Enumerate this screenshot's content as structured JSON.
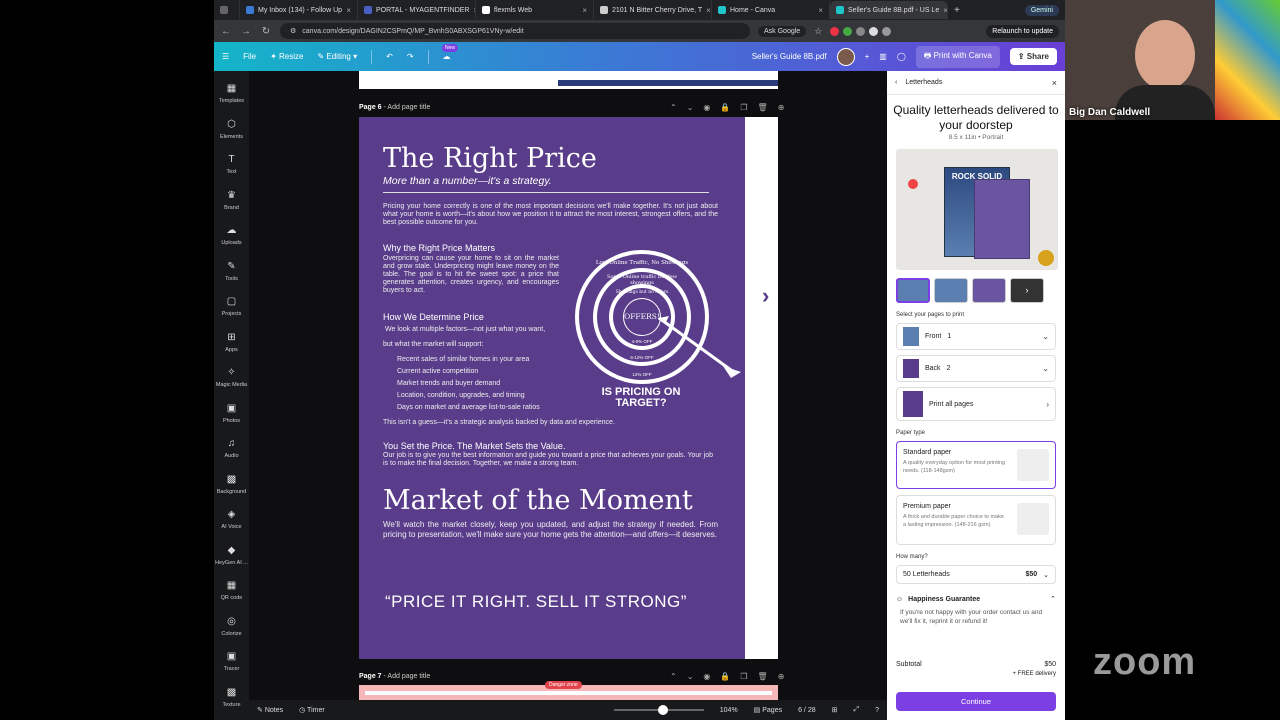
{
  "tabs": [
    {
      "title": "My Inbox (134) - Follow Up",
      "active": false
    },
    {
      "title": "PORTAL - MYAGENTFINDER",
      "active": false
    },
    {
      "title": "flexmls Web",
      "active": false
    },
    {
      "title": "2101 N Bitter Cherry Drive, T",
      "active": false
    },
    {
      "title": "Home - Canva",
      "active": false
    },
    {
      "title": "Seller's Guide 8B.pdf - US Le",
      "active": true
    }
  ],
  "gemini_label": "Gemini",
  "url": "canva.com/design/DAGIN2CSPmQ/MP_BvnhS0ABXSGP61VNy-w/edit",
  "ask_google": "Ask Google",
  "relaunch": "Relaunch to update",
  "canva": {
    "file": "File",
    "resize": "Resize",
    "editing": "Editing",
    "new_badge": "New",
    "doc_title": "Seller's Guide 8B.pdf",
    "print_with_canva": "Print with Canva",
    "share": "Share"
  },
  "rail": [
    "Templates",
    "Elements",
    "Text",
    "Brand",
    "Uploads",
    "Tools",
    "Projects",
    "Apps",
    "Magic Media",
    "Photos",
    "Audio",
    "Background",
    "AI Voice",
    "HeyGen AI ...",
    "QR code",
    "Colorize",
    "Tracer",
    "Texture"
  ],
  "page6": {
    "label": "Page 6",
    "add_title": "- Add page title",
    "title": "The Right Price",
    "subtitle": "More than a number—it's a strategy.",
    "intro": "Pricing your home correctly is one of the most important decisions we'll make together. It's not just about what your home is worth—it's about how we position it to attract the most interest, strongest offers, and the best possible outcome for you.",
    "h_why": "Why the Right Price Matters",
    "why": "Overpricing can cause your home to sit on the market and grow stale. Underpricing might leave money on the table. The goal is to hit the sweet spot: a price that generates attention, creates urgency, and encourages buyers to act.",
    "h_how": "How We Determine Price",
    "how1": "We look at multiple factors—not just what you want,",
    "how2": "but what the market will support:",
    "bullets": [
      "Recent sales of similar homes in your area",
      "Current active competition",
      "Market trends and buyer demand",
      "Location, condition, upgrades, and timing",
      "Days on market and average list-to-sale ratios"
    ],
    "guess": "This isn't a guess—it's a strategic analysis backed by data and experience.",
    "h_set": "You Set the Price. The Market Sets the Value.",
    "set": "Our job is to give you the best information and guide you toward a price that achieves your goals. Your job is to make the final decision. Together, we make a strong team.",
    "moment_title": "Market of the Moment",
    "moment": "We'll watch the market closely, keep you updated, and adjust the strategy if needed. From pricing to presentation, we'll make sure your home gets the attention—and offers—it deserves.",
    "quote": "“PRICE IT RIGHT. SELL IT STRONG”",
    "target": {
      "outer": "Low Online Traffic, No Showings",
      "mid": "Some Online traffic but few showings",
      "inner": "Showings but no offers",
      "center": "OFFERS!",
      "r1": "4-6% OFF",
      "r2": "6-12% OFF",
      "r3": "12% OFF",
      "caption": "IS PRICING ON TARGET?"
    }
  },
  "page7": {
    "label": "Page 7",
    "add_title": "- Add page title",
    "danger": "Danger zone"
  },
  "bottom": {
    "notes": "Notes",
    "timer": "Timer",
    "zoom": "104%",
    "pages": "Pages",
    "page_count": "6 / 28"
  },
  "panel": {
    "header": "Letterheads",
    "title": "Quality letterheads delivered to your doorstep",
    "subtitle": "8.5 x 11in • Portrait",
    "product_book_title": "ROCK SOLID",
    "select_label": "Select your pages to print",
    "front": "Front",
    "front_n": "1",
    "back": "Back",
    "back_n": "2",
    "print_all": "Print all pages",
    "paper_type": "Paper type",
    "std_title": "Standard paper",
    "std_desc": "A quality everyday option for most printing needs. (118-148gsm)",
    "prem_title": "Premium paper",
    "prem_desc": "A thick and durable paper choice to make a lasting impression. (148-216 gsm)",
    "how_many": "How many?",
    "qty": "50 Letterheads",
    "qty_price": "$50",
    "guarantee": "Happiness Guarantee",
    "guarantee_text": "If you're not happy with your order contact us and we'll fix it, reprint it or refund it!",
    "subtotal": "Subtotal",
    "subtotal_val": "$50",
    "delivery": "+ FREE delivery",
    "continue": "Continue"
  },
  "webcam_name": "Big Dan Caldwell",
  "zoom_logo": "zoom"
}
